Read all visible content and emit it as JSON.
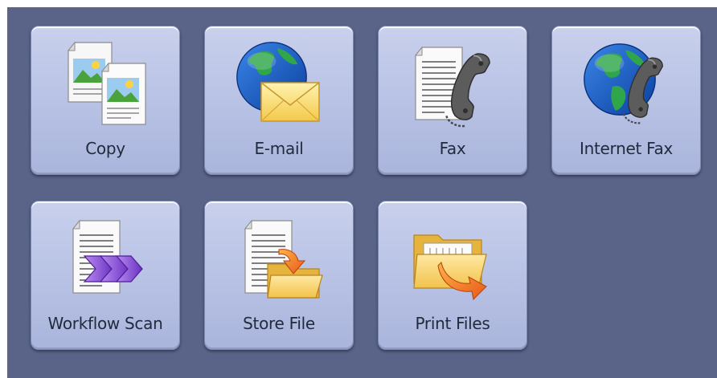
{
  "screen": {
    "background_color": "#5a6488",
    "tile_color": "#bcc5e7"
  },
  "apps": [
    {
      "id": "copy",
      "label": "Copy",
      "icon": "copy-icon"
    },
    {
      "id": "email",
      "label": "E-mail",
      "icon": "email-icon"
    },
    {
      "id": "fax",
      "label": "Fax",
      "icon": "fax-icon"
    },
    {
      "id": "internet-fax",
      "label": "Internet Fax",
      "icon": "internet-fax-icon"
    },
    {
      "id": "workflow-scan",
      "label": "Workflow Scan",
      "icon": "workflow-scan-icon"
    },
    {
      "id": "store-file",
      "label": "Store File",
      "icon": "store-file-icon"
    },
    {
      "id": "print-files",
      "label": "Print Files",
      "icon": "print-files-icon"
    }
  ]
}
